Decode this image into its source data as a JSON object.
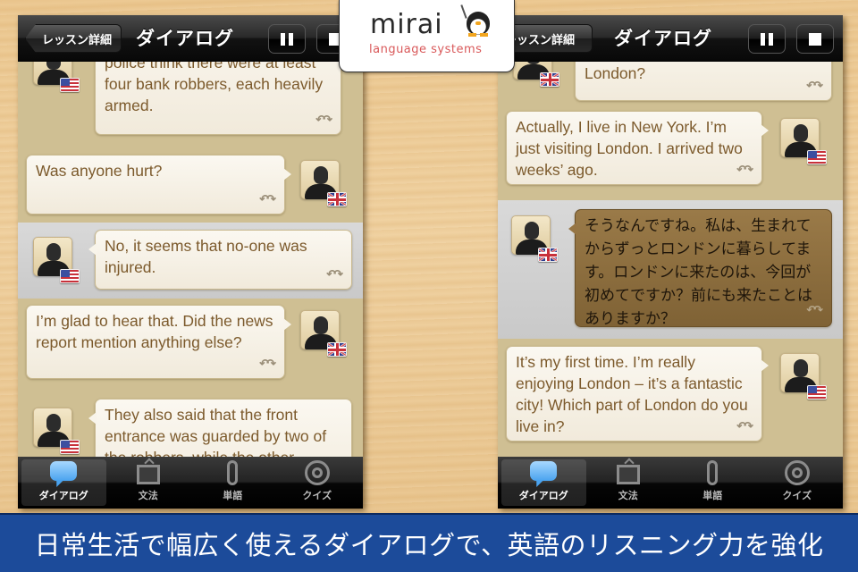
{
  "logo": {
    "brand": "mirai",
    "tagline": "language systems",
    "mascot": "penguin-icon"
  },
  "screens": [
    {
      "navbar": {
        "back_label": "レッスン詳細",
        "title": "ダイアログ",
        "pause_icon": "pause-icon",
        "stop_icon": "stop-icon"
      },
      "messages": [
        {
          "side": "right",
          "speaker_flag": "us",
          "text": "police think there were at least four bank robbers, each heavily armed.",
          "highlighted": false
        },
        {
          "side": "left",
          "speaker_flag": "uk",
          "text": "Was anyone hurt?",
          "highlighted": false
        },
        {
          "side": "right",
          "speaker_flag": "us",
          "text": "No, it seems that no-one was injured.",
          "highlighted": true
        },
        {
          "side": "left",
          "speaker_flag": "uk",
          "text": "I’m glad to hear that. Did the news report mention anything else?",
          "highlighted": false
        },
        {
          "side": "right",
          "speaker_flag": "us",
          "text": "They also said that the front entrance was guarded by two of the robbers, while the other",
          "highlighted": false
        }
      ],
      "tabs": [
        {
          "label": "ダイアログ",
          "icon": "speech-bubble-icon",
          "active": true
        },
        {
          "label": "文法",
          "icon": "picture-frame-icon",
          "active": false
        },
        {
          "label": "単語",
          "icon": "paperclip-icon",
          "active": false
        },
        {
          "label": "クイズ",
          "icon": "target-icon",
          "active": false
        }
      ]
    },
    {
      "navbar": {
        "back_label": "レッスン詳細",
        "title": "ダイアログ",
        "pause_icon": "pause-icon",
        "stop_icon": "stop-icon"
      },
      "messages": [
        {
          "side": "right",
          "speaker_flag": "uk",
          "text": "London?",
          "highlighted": false
        },
        {
          "side": "left",
          "speaker_flag": "us",
          "text": "Actually, I live in New York. I’m just visiting London. I arrived two weeks’ ago.",
          "highlighted": false
        },
        {
          "side": "right",
          "speaker_flag": "uk",
          "text": "そうなんですね。私は、生まれてからずっとロンドンに暮らしてます。ロンドンに来たのは、今回が初めてですか？前にも来たことはありますか？",
          "highlighted": true,
          "translated": true
        },
        {
          "side": "left",
          "speaker_flag": "us",
          "text": "It’s my first time. I’m really enjoying London – it’s a fantastic city! Which part of London do you live in?",
          "highlighted": false
        }
      ],
      "tabs": [
        {
          "label": "ダイアログ",
          "icon": "speech-bubble-icon",
          "active": true
        },
        {
          "label": "文法",
          "icon": "picture-frame-icon",
          "active": false
        },
        {
          "label": "単語",
          "icon": "paperclip-icon",
          "active": false
        },
        {
          "label": "クイズ",
          "icon": "target-icon",
          "active": false
        }
      ]
    }
  ],
  "repeat_icon": "repeat-icon",
  "banner": {
    "text": "日常生活で幅広く使えるダイアログで、英語のリスニング力を強化"
  },
  "colors": {
    "banner_bg": "#1c4b9a",
    "bubble_text": "#7c5a2c",
    "translated_bubble_bg": "#8a6b3d",
    "logo_tagline": "#d9595a",
    "tab_active_icon": "#4aa3ef"
  }
}
